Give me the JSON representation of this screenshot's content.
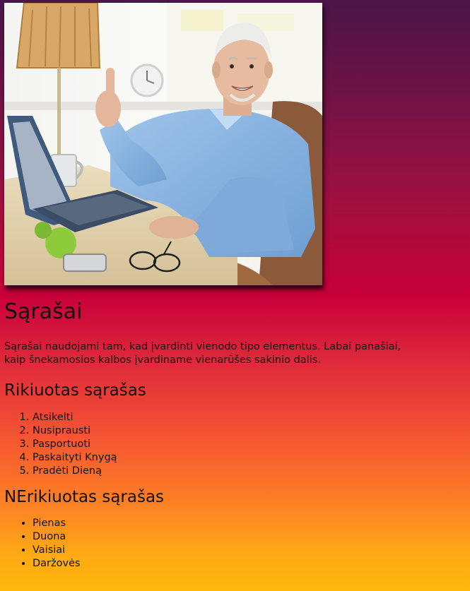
{
  "content": {
    "image_alt": "Vyras prie nešiojamojo kompiuterio rodo nykštį",
    "title": "Sąrašai",
    "intro": "Sąrašai naudojami tam, kad įvardinti vienodo tipo elementus. Labai panašiai, kaip šnekamosios kalbos įvardiname vienarūšes sakinio dalis.",
    "ordered_heading": "Rikiuotas sąrašas",
    "ordered_items": [
      "Atsikelti",
      "Nusiprausti",
      "Pasportuoti",
      "Paskaityti Knygą",
      "Pradėti Dieną"
    ],
    "unordered_heading": "NErikiuotas sąrašas",
    "unordered_items": [
      "Pienas",
      "Duona",
      "Vaisiai",
      "Daržovės"
    ]
  }
}
